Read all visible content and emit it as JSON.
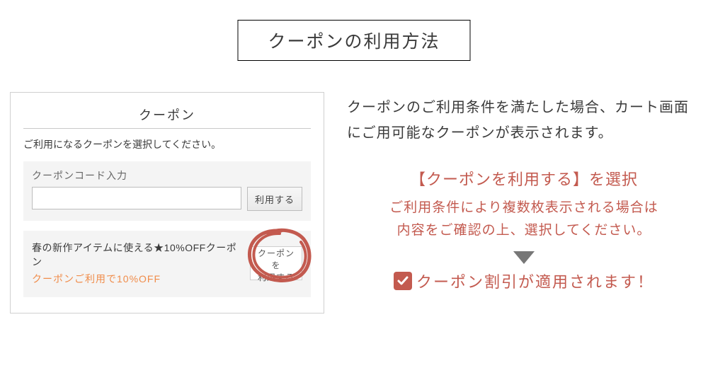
{
  "title": "クーポンの利用方法",
  "panel": {
    "heading": "クーポン",
    "instruction": "ご利用になるクーポンを選択してください。",
    "code_label": "クーポンコード入力",
    "code_value": "",
    "apply_label": "利用する",
    "item": {
      "name": "春の新作アイテムに使える★10%OFFクーポン",
      "desc": "クーポンご利用で10%OFF",
      "use_line1": "クーポンを",
      "use_line2": "利用する"
    }
  },
  "explain": {
    "intro": "クーポンのご利用条件を満たした場合、カート画面にご用可能なクーポンが表示されます。",
    "action_title": "【クーポンを利用する】を選択",
    "note_line1": "ご利用条件により複数枚表示される場合は",
    "note_line2": "内容をご確認の上、選択してください。",
    "result": "クーポン割引が適用されます！"
  },
  "colors": {
    "accent_red": "#c35a4f",
    "accent_orange": "#f08c4a"
  }
}
